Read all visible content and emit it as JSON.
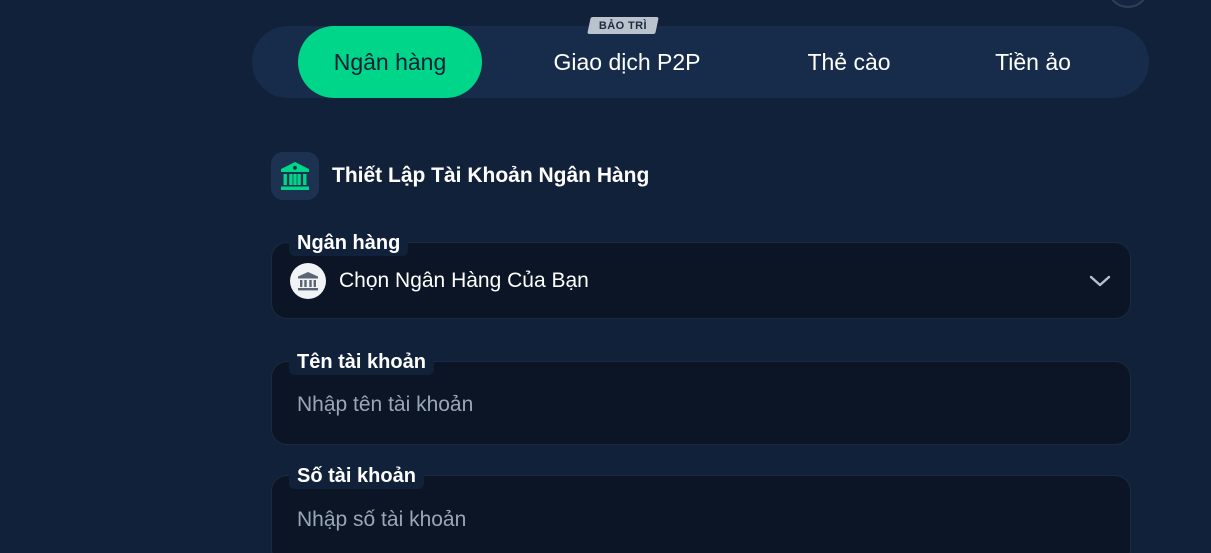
{
  "tabs": [
    {
      "label": "Ngân hàng",
      "active": true
    },
    {
      "label": "Giao dịch P2P",
      "badge": "BẢO TRÌ"
    },
    {
      "label": "Thẻ cào"
    },
    {
      "label": "Tiền ảo"
    }
  ],
  "section": {
    "title": "Thiết Lập Tài Khoản Ngân Hàng",
    "icon": "bank-icon"
  },
  "form": {
    "bank": {
      "label": "Ngân hàng",
      "selected": "Chọn Ngân Hàng Của Bạn",
      "icon": "bank-icon",
      "chevron_icon": "chevron-down-icon"
    },
    "account_name": {
      "label": "Tên tài khoản",
      "placeholder": "Nhập tên tài khoản",
      "value": ""
    },
    "account_number": {
      "label": "Số tài khoản",
      "placeholder": "Nhập số tài khoản",
      "value": ""
    }
  },
  "colors": {
    "background": "#12213a",
    "tabbar": "#172c4b",
    "accent": "#00d68a",
    "field_bg": "#0b1525",
    "badge_bg": "#b9c2cd"
  }
}
